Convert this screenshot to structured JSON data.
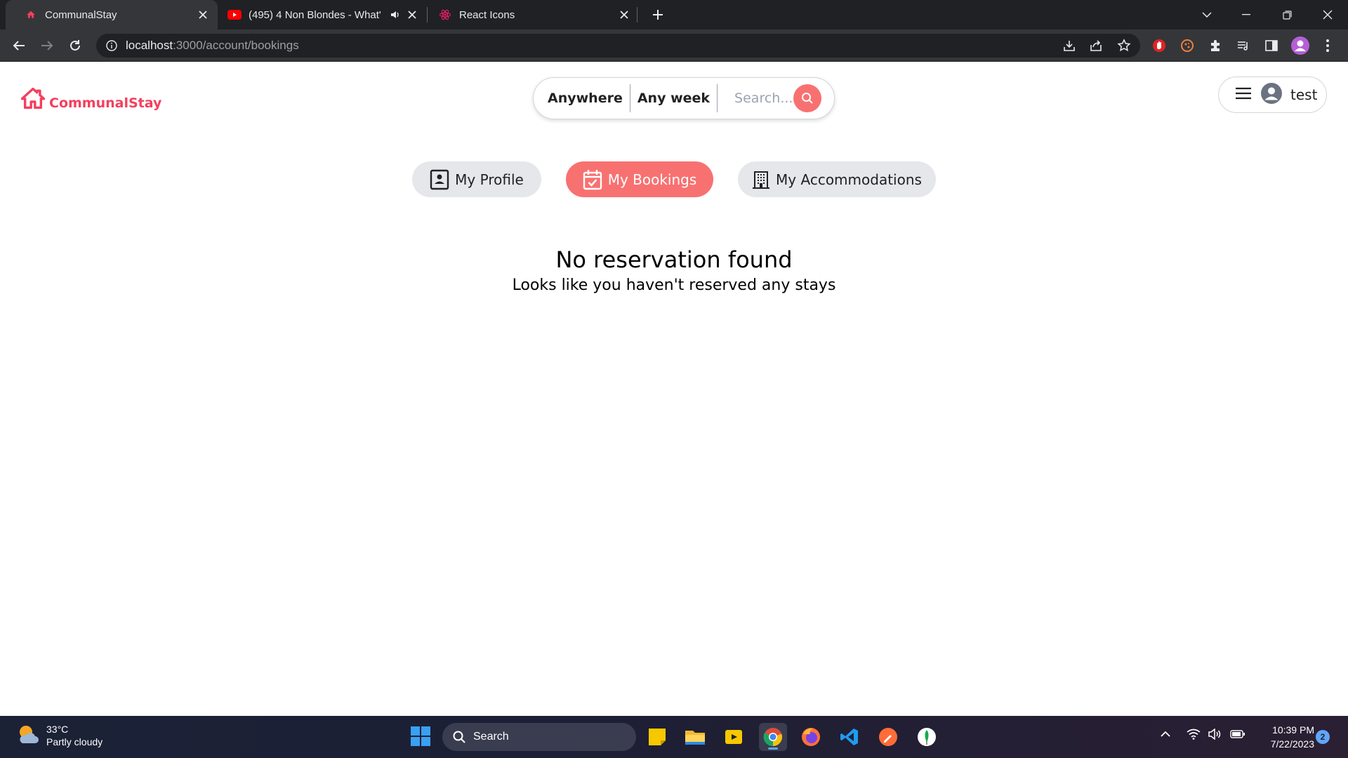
{
  "browser": {
    "tabs": [
      {
        "title": "CommunalStay",
        "active": true
      },
      {
        "title": "(495) 4 Non Blondes - What'",
        "active": false
      },
      {
        "title": "React Icons",
        "active": false
      }
    ],
    "url_host": "localhost",
    "url_rest": ":3000/account/bookings"
  },
  "header": {
    "brand": "CommunalStay",
    "search": {
      "anywhere": "Anywhere",
      "any_week": "Any week",
      "placeholder": "Search..."
    },
    "user_name": "test"
  },
  "account_nav": [
    {
      "label": "My Profile",
      "icon": "profile-icon",
      "active": false
    },
    {
      "label": "My Bookings",
      "icon": "calendar-check-icon",
      "active": true
    },
    {
      "label": "My Accommodations",
      "icon": "building-icon",
      "active": false
    }
  ],
  "empty_state": {
    "title": "No reservation found",
    "subtitle": "Looks like you haven't reserved any stays"
  },
  "taskbar": {
    "weather_temp": "33°C",
    "weather_desc": "Partly cloudy",
    "search_label": "Search",
    "time": "10:39 PM",
    "date": "7/22/2023",
    "notifications": "2"
  },
  "colors": {
    "brand": "#f43f5e",
    "accent": "#f87171",
    "pill_inactive": "#e5e7eb"
  }
}
